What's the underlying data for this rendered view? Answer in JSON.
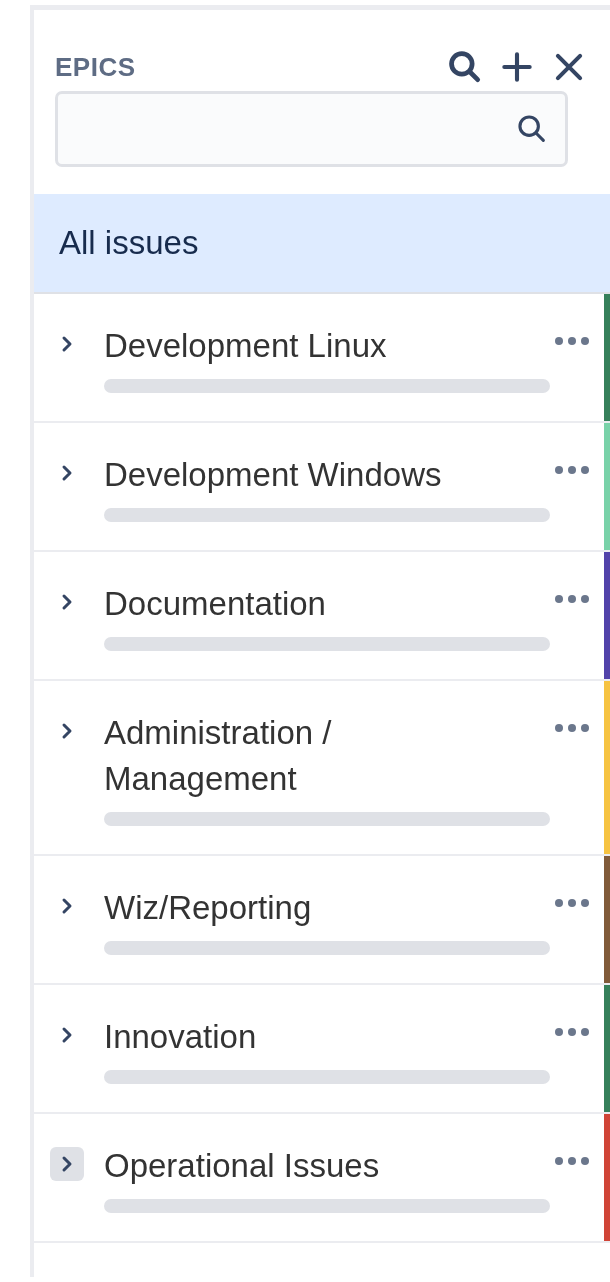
{
  "panel": {
    "title": "EPICS"
  },
  "all_issues": {
    "label": "All issues",
    "selected": true
  },
  "epics": [
    {
      "name": "Development Linux",
      "color": "#36805b",
      "level": 0,
      "hovered": false
    },
    {
      "name": "Development Windows",
      "color": "#79d2a9",
      "level": 0,
      "hovered": false
    },
    {
      "name": "Documentation",
      "color": "#5243aa",
      "level": 0,
      "hovered": false
    },
    {
      "name": "Administration / Management",
      "color": "#f6c342",
      "level": 0,
      "hovered": false
    },
    {
      "name": "Wiz/Reporting",
      "color": "#815b3a",
      "level": 0,
      "hovered": false
    },
    {
      "name": "Innovation",
      "color": "#36805b",
      "level": 0,
      "hovered": false
    },
    {
      "name": "Operational Issues",
      "color": "#d04437",
      "level": 0,
      "hovered": true
    }
  ]
}
